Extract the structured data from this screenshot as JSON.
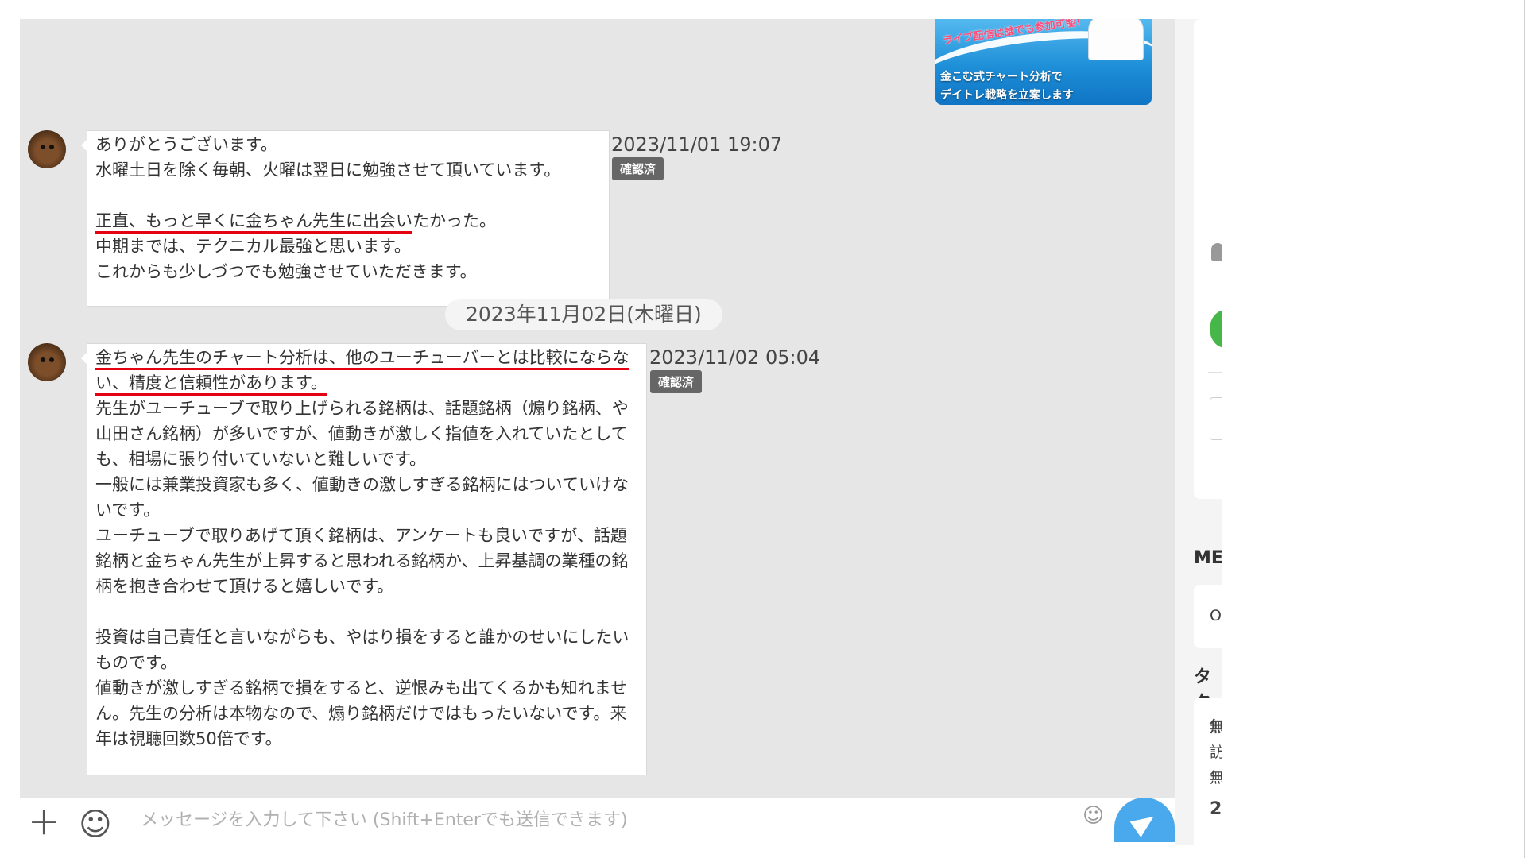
{
  "promo": {
    "banner": "ライブ配信は誰でも参加可能！",
    "line1": "金こむ式チャート分析で",
    "line2": "デイトレ戦略を立案します"
  },
  "messages": [
    {
      "lines_plain_before": "ありがとうございます。\n水曜土日を除く毎朝、火曜は翌日に勉強させて頂いています。\n\n",
      "underlined": "正直、もっと早くに金ちゃん先生に出会い",
      "after_underline": "たかった。\n中期までは、テクニカル最強と思います。\nこれからも少しづつでも勉強させていただきます。",
      "time": "2023/11/01 19:07",
      "badge": "確認済"
    },
    {
      "underlined": "金ちゃん先生のチャート分析は、他のユーチューバーとは比較にならない、精度と信頼性があります。",
      "body": "\n先生がユーチューブで取り上げられる銘柄は、話題銘柄（煽り銘柄、や山田さん銘柄）が多いですが、値動きが激しく指値を入れていたとしても、相場に張り付いていないと難しいです。\n一般には兼業投資家も多く、値動きの激しすぎる銘柄にはついていけないです。\nユーチューブで取りあげて頂く銘柄は、アンケートも良いですが、話題銘柄と金ちゃん先生が上昇すると思われる銘柄か、上昇基調の業種の銘柄を抱き合わせて頂けると嬉しいです。\n\n投資は自己責任と言いながらも、やはり損をすると誰かのせいにしたいものです。\n値動きが激しすぎる銘柄で損をすると、逆恨みも出てくるかも知れません。先生の分析は本物なので、煽り銘柄だけではもったいないです。来年は視聴回数50倍です。",
      "time": "2023/11/02 05:04",
      "badge": "確認済"
    }
  ],
  "date_separator": "2023年11月02日(木曜日)",
  "input": {
    "placeholder": "メッセージを入力して下さい (Shift+Enterでも送信できます)"
  },
  "sidebar": {
    "heading1": "MEI",
    "item1": "O",
    "heading2": "タク",
    "tags": [
      "無",
      "訪",
      "無",
      "2"
    ]
  }
}
